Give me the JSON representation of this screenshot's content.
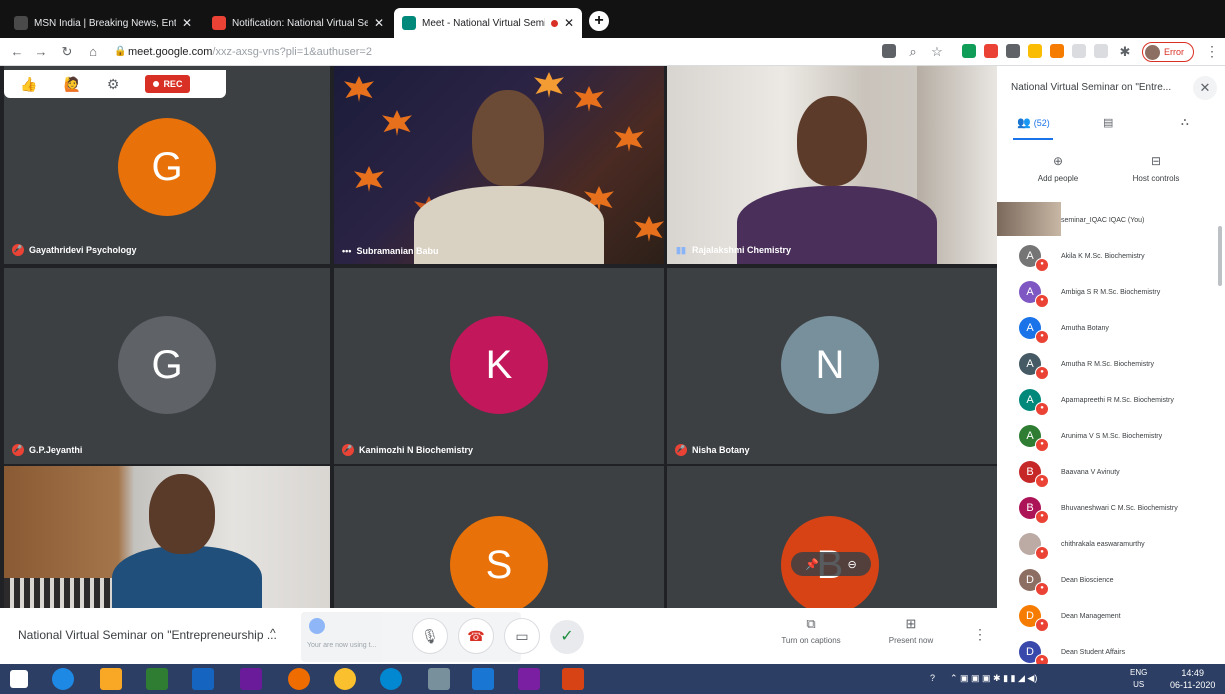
{
  "browser": {
    "tabs": [
      {
        "title": "MSN India | Breaking News, Ente",
        "favicon_color": "#4a4a4a"
      },
      {
        "title": "Notification: National Virtual Sem",
        "favicon_color": "#ea4335"
      },
      {
        "title": "Meet - National Virtual Semi",
        "favicon_color": "#00897b",
        "active": true
      }
    ],
    "tab_close": "✕",
    "new_tab": "+",
    "url_host": "meet.google.com",
    "url_path": "/xxz-axsg-vns?pli=1&authuser=2",
    "profile_label": "Error"
  },
  "meet": {
    "rec_label": "REC",
    "tiles": [
      {
        "name": "Gayathridevi Psychology",
        "initial": "G",
        "color": "#e8710a",
        "mic": "off"
      },
      {
        "name": "Subramanian Babu",
        "mic": "more"
      },
      {
        "name": "Rajalakshmi Chemistry",
        "mic": "on"
      },
      {
        "name": "G.P.Jeyanthi",
        "initial": "G",
        "color": "#5f6368",
        "mic": "off"
      },
      {
        "name": "Kanimozhi N Biochemistry",
        "initial": "K",
        "color": "#c2185b",
        "mic": "off"
      },
      {
        "name": "Nisha Botany",
        "initial": "N",
        "color": "#78909c",
        "mic": "off"
      },
      {
        "initial": "S",
        "color": "#e8710a"
      },
      {
        "initial": "B",
        "color": "#d84315"
      }
    ]
  },
  "bottombar": {
    "meeting_title": "National Virtual Seminar on \"Entrepreneurship ...",
    "chevron": "^",
    "captions_label": "Turn on captions",
    "present_label": "Present now",
    "caption_hint": "Your are now using t..."
  },
  "panel": {
    "title": "National Virtual Seminar on \"Entre...",
    "people_count": "(52)",
    "add_people_label": "Add people",
    "host_controls_label": "Host controls",
    "participants": [
      {
        "name": "seminar_IQAC IQAC (You)",
        "self": true
      },
      {
        "name": "Akila K M.Sc. Biochemistry",
        "initial": "A",
        "color": "#757575"
      },
      {
        "name": "Ambiga S R M.Sc. Biochemistry",
        "initial": "A",
        "color": "#7e57c2"
      },
      {
        "name": "Amutha Botany",
        "initial": "A",
        "color": "#1a73e8"
      },
      {
        "name": "Amutha R M.Sc. Biochemistry",
        "initial": "A",
        "color": "#455a64"
      },
      {
        "name": "Aparnapreethi R M.Sc. Biochemistry",
        "initial": "A",
        "color": "#00897b"
      },
      {
        "name": "Arunima V S M.Sc. Biochemistry",
        "initial": "A",
        "color": "#2e7d32"
      },
      {
        "name": "Baavana V Avinuty",
        "initial": "B",
        "color": "#c62828"
      },
      {
        "name": "Bhuvaneshwari C M.Sc. Biochemistry",
        "initial": "B",
        "color": "#ad1457"
      },
      {
        "name": "chithrakala easwaramurthy",
        "initial": "",
        "color": "#bcaaa4"
      },
      {
        "name": "Dean Bioscience",
        "initial": "D",
        "color": "#8d6e63"
      },
      {
        "name": "Dean Management",
        "initial": "D",
        "color": "#f57c00"
      },
      {
        "name": "Dean Student Affairs",
        "initial": "D",
        "color": "#3949ab"
      }
    ]
  },
  "taskbar": {
    "lang": "ENG",
    "region": "US",
    "time": "14:49",
    "date": "06-11-2020"
  }
}
